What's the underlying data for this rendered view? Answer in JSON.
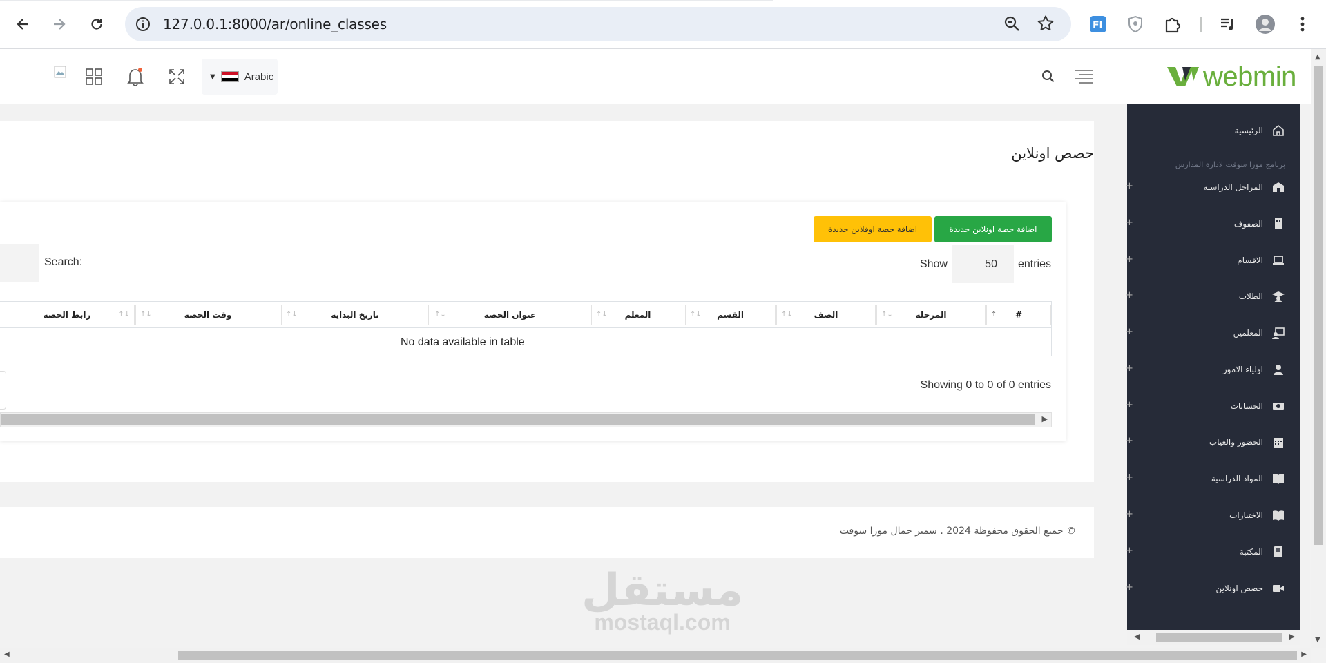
{
  "browser": {
    "url": "127.0.0.1:8000/ar/online_classes"
  },
  "header": {
    "language": "Arabic"
  },
  "logo": {
    "text": "webmin",
    "color": "#6aaf3d"
  },
  "sidebar": {
    "subtitle": "برنامج مورا سوفت لادارة المدارس",
    "items": [
      {
        "label": "الرئيسية",
        "icon": "home-icon"
      },
      {
        "label": "المراحل الدراسية",
        "icon": "school-icon"
      },
      {
        "label": "الصفوف",
        "icon": "building-icon"
      },
      {
        "label": "الاقسام",
        "icon": "laptop-icon"
      },
      {
        "label": "الطلاب",
        "icon": "graduate-icon"
      },
      {
        "label": "المعلمين",
        "icon": "teacher-icon"
      },
      {
        "label": "اولياء الامور",
        "icon": "user-icon"
      },
      {
        "label": "الحسابات",
        "icon": "money-icon"
      },
      {
        "label": "الحضور والغياب",
        "icon": "calendar-icon"
      },
      {
        "label": "المواد الدراسية",
        "icon": "book-icon"
      },
      {
        "label": "الاختبارات",
        "icon": "book-open-icon"
      },
      {
        "label": "المكتبة",
        "icon": "library-icon"
      },
      {
        "label": "حصص اونلاين",
        "icon": "video-icon"
      }
    ]
  },
  "page": {
    "title": "حصص اونلاين"
  },
  "actions": {
    "add_online": "اضافة حصة اونلاين جديدة",
    "add_offline": "اضافة حصة اوفلاين جديدة",
    "add_online_color": "#28a745",
    "add_offline_color": "#ffc107"
  },
  "table_controls": {
    "show": "Show",
    "length": "50",
    "entries": "entries",
    "search": "Search:"
  },
  "table": {
    "columns": [
      "#",
      "المرحلة",
      "الصف",
      "القسم",
      "المعلم",
      "عنوان الحصة",
      "تاريخ البداية",
      "وقت الحصة",
      "رابط الحصة"
    ],
    "empty": "No data available in table",
    "info": "Showing 0 to 0 of 0 entries"
  },
  "footer": {
    "copyright": "© جميع الحقوق محفوظة 2024 . سمير جمال مورا سوفت"
  },
  "watermark": {
    "arabic": "مستقل",
    "latin": "mostaql.com"
  }
}
